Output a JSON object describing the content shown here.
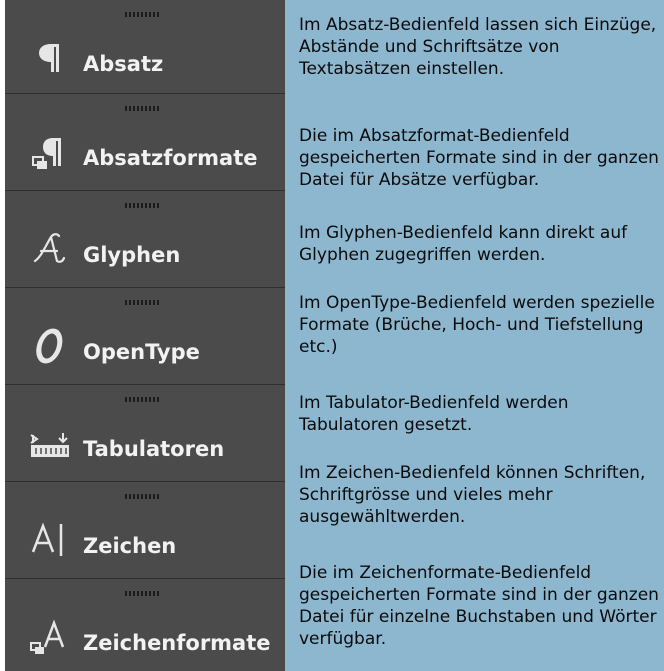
{
  "panels": [
    {
      "label": "Absatz",
      "icon": "pilcrow-icon"
    },
    {
      "label": "Absatzformate",
      "icon": "paragraph-styles-icon"
    },
    {
      "label": "Glyphen",
      "icon": "glyph-icon"
    },
    {
      "label": "OpenType",
      "icon": "opentype-icon"
    },
    {
      "label": "Tabulatoren",
      "icon": "tabulator-ruler-icon"
    },
    {
      "label": "Zeichen",
      "icon": "character-icon"
    },
    {
      "label": "Zeichenformate",
      "icon": "character-styles-icon"
    }
  ],
  "descriptions": [
    "Im Absatz-Bedienfeld lassen sich Einzüge, Abstände und Schriftsätze von Textabsätzen einstellen.",
    "Die im Absatzformat-Bedienfeld gespeicherten Formate sind in der ganzen Datei für Absätze verfügbar.",
    "Im Glyphen-Bedienfeld kann direkt auf Glyphen zugegriffen werden.",
    "Im OpenType-Bedienfeld werden spezielle Formate (Brüche, Hoch- und Tiefstellung etc.)",
    "Im Tabulator-Bedienfeld werden Tabulatoren gesetzt.",
    "Im Zeichen-Bedienfeld können Schriften, Schriftgrösse und vieles mehr ausgewähltwerden.",
    "Die im Zeichenformate-Bedienfeld gespeicherten Formate sind in der ganzen Datei für einzelne Buchstaben und Wörter verfügbar."
  ],
  "colors": {
    "panel_bg": "#4b4b4b",
    "panel_text": "#f2f2f2",
    "description_bg": "#8db6cf",
    "description_text": "#0b0b0b"
  }
}
